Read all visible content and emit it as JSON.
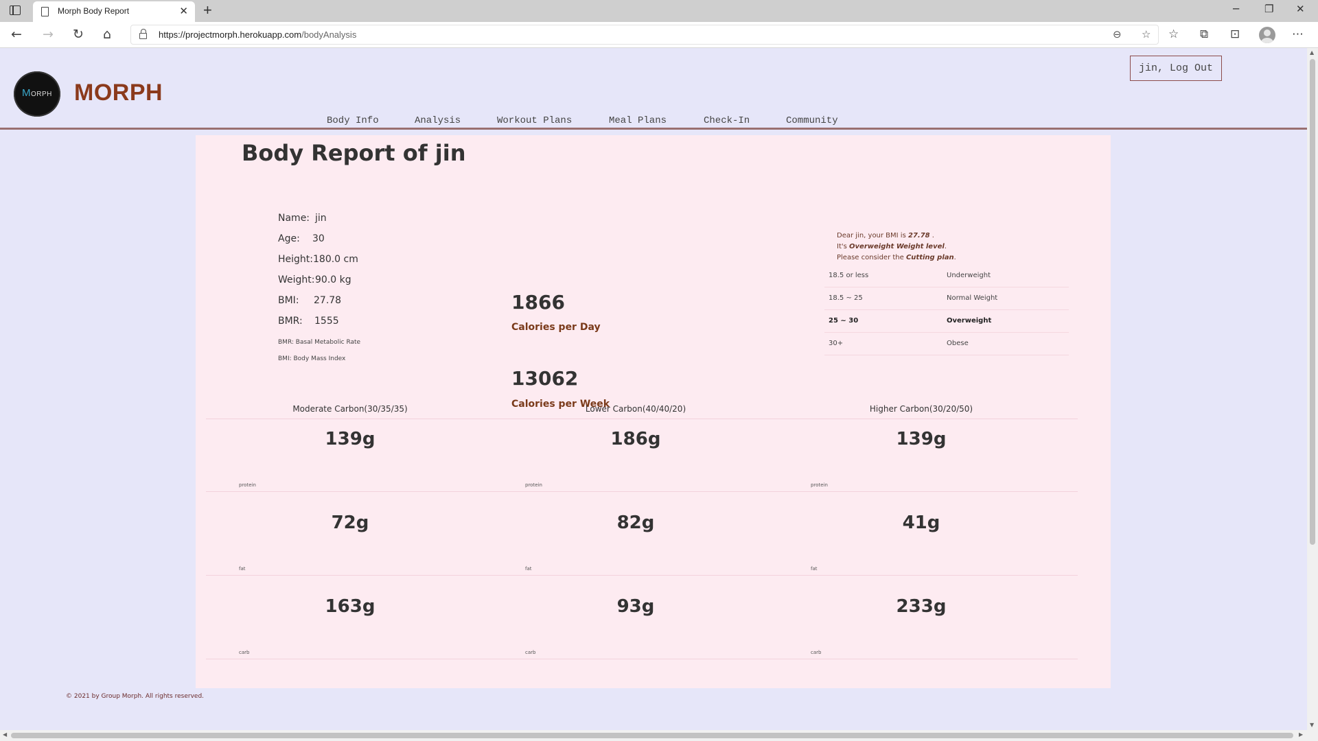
{
  "browser": {
    "tab_title": "Morph Body Report",
    "tab_close": "✕",
    "new_tab": "+",
    "url_host": "https://projectmorph.herokuapp.com",
    "url_path": "/bodyAnalysis",
    "window_controls": {
      "minimize": "─",
      "restore": "❐",
      "close": "✕"
    }
  },
  "site": {
    "brand": "MORPH",
    "logo_text_m": "M",
    "logo_text_rest": "ORPH",
    "logout_label": "jin, Log Out",
    "nav": [
      "Body Info",
      "Analysis",
      "Workout Plans",
      "Meal Plans",
      "Check-In",
      "Community"
    ],
    "footer": "© 2021 by Group Morph. All rights reserved."
  },
  "report": {
    "title": "Body Report of jin",
    "info": {
      "name_label": "Name:",
      "name": "jin",
      "age_label": "Age:",
      "age": "30",
      "height_label": "Height:",
      "height": "180.0 cm",
      "weight_label": "Weight:",
      "weight": "90.0 kg",
      "bmi_label": "BMI:",
      "bmi": "27.78",
      "bmr_label": "BMR:",
      "bmr": "1555",
      "note_bmr": "BMR: Basal Metabolic Rate",
      "note_bmi": "BMI: Body Mass Index"
    },
    "calories": {
      "per_day": "1866",
      "per_day_label": "Calories per Day",
      "per_week": "13062",
      "per_week_label": "Calories per Week"
    },
    "bmi_message": {
      "line1_prefix": "Dear jin, your BMI is ",
      "line1_value": "27.78",
      "line1_suffix": " .",
      "line2_prefix": "It's ",
      "line2_value": "Overweight Weight level",
      "line2_suffix": ".",
      "line3_prefix": "Please consider the ",
      "line3_value": "Cutting plan",
      "line3_suffix": "."
    },
    "bmi_table": [
      {
        "range": "18.5 or less",
        "label": "Underweight"
      },
      {
        "range": "18.5 ~ 25",
        "label": "Normal Weight"
      },
      {
        "range": "25 ~ 30",
        "label": "Overweight"
      },
      {
        "range": "30+",
        "label": "Obese"
      }
    ],
    "macros": {
      "plans": [
        "Moderate Carbon(30/35/35)",
        "Lower Carbon(40/40/20)",
        "Higher Carbon(30/20/50)"
      ],
      "protein": [
        "139g",
        "186g",
        "139g"
      ],
      "fat": [
        "72g",
        "82g",
        "41g"
      ],
      "carb": [
        "163g",
        "93g",
        "233g"
      ],
      "protein_tag": "protein",
      "fat_tag": "fat",
      "carb_tag": "carb"
    }
  }
}
